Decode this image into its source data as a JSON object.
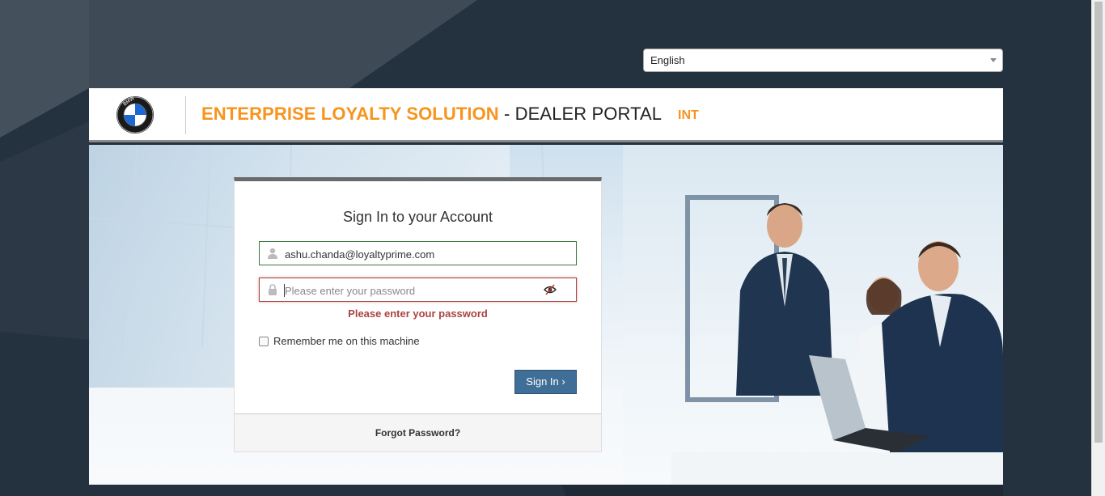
{
  "language_select": {
    "value": "English"
  },
  "header": {
    "title_brand": "ENTERPRISE LOYALTY SOLUTION",
    "title_separator": " - ",
    "title_portal": "DEALER PORTAL",
    "environment": "INT",
    "logo_letters": "BMW"
  },
  "login": {
    "heading": "Sign In to your Account",
    "email_value": "ashu.chanda@loyaltyprime.com",
    "password_placeholder": "Please enter your password",
    "password_error": "Please enter your password",
    "remember_label": "Remember me on this machine",
    "signin_label": "Sign In ›",
    "forgot_label": "Forgot Password?"
  },
  "colors": {
    "accent_orange": "#f7941d",
    "button_blue": "#3f6e96",
    "error_red": "#a94442",
    "success_green": "#3c763d"
  }
}
